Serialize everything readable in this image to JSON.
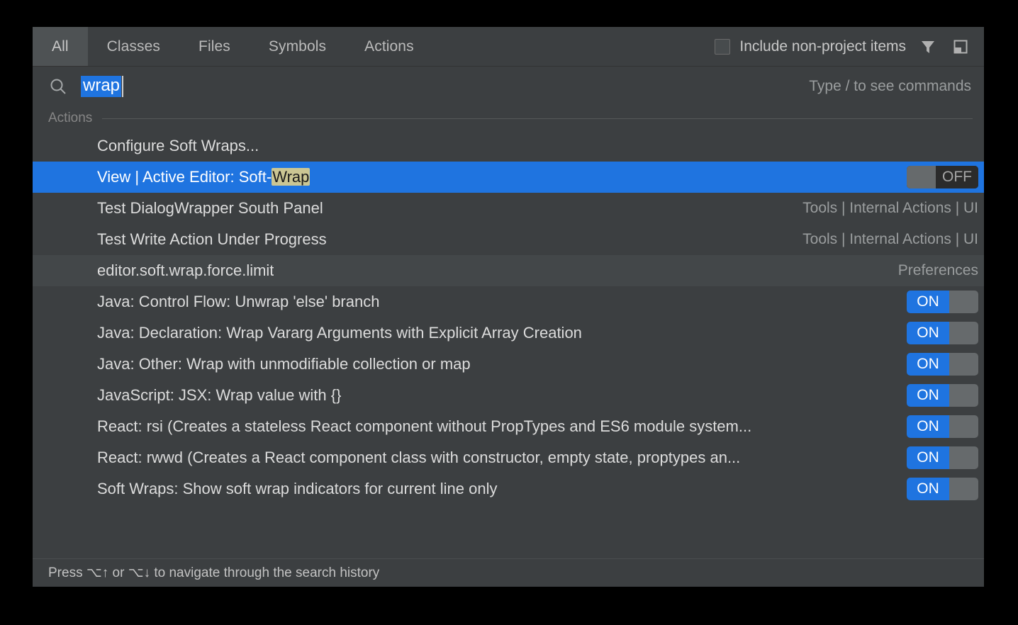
{
  "colors": {
    "dialog_bg": "#3c3f41",
    "selection_blue": "#1f74e0",
    "match_highlight": "#cbc693",
    "row_hover": "#434749",
    "tab_selected_bg": "#4e5254",
    "secondary_text": "#9a9d9e",
    "toggle_knob": "#666a6c",
    "toggle_off_bg": "#2b2b2b"
  },
  "header": {
    "tabs": [
      {
        "label": "All",
        "selected": true
      },
      {
        "label": "Classes",
        "selected": false
      },
      {
        "label": "Files",
        "selected": false
      },
      {
        "label": "Symbols",
        "selected": false
      },
      {
        "label": "Actions",
        "selected": false
      }
    ],
    "non_project": {
      "label": "Include non-project items",
      "checked": false
    },
    "icons": [
      {
        "name": "filter-icon"
      },
      {
        "name": "preview-panel-icon"
      }
    ]
  },
  "search": {
    "icon": "search-icon",
    "value": "wrap",
    "selected": true,
    "hint": "Type / to see commands"
  },
  "results": {
    "group_label": "Actions",
    "rows": [
      {
        "title": "Configure Soft Wraps...",
        "title_pre": "Configure Soft Wraps...",
        "match": "",
        "title_post": "",
        "location": "",
        "toggle": null,
        "state": "normal"
      },
      {
        "title": "View | Active Editor: Soft-Wrap",
        "title_pre": "View | Active Editor: Soft-",
        "match": "Wrap",
        "title_post": "",
        "location": "",
        "toggle": "OFF",
        "state": "selected"
      },
      {
        "title": "Test DialogWrapper South Panel",
        "title_pre": "Test DialogWrapper South Panel",
        "match": "",
        "title_post": "",
        "location": "Tools | Internal Actions | UI",
        "toggle": null,
        "state": "normal"
      },
      {
        "title": "Test Write Action Under Progress",
        "title_pre": "Test Write Action Under Progress",
        "match": "",
        "title_post": "",
        "location": "Tools | Internal Actions | UI",
        "toggle": null,
        "state": "normal"
      },
      {
        "title": "editor.soft.wrap.force.limit",
        "title_pre": "editor.soft.wrap.force.limit",
        "match": "",
        "title_post": "",
        "location": "Preferences",
        "toggle": null,
        "state": "hover"
      },
      {
        "title": "Java: Control Flow: Unwrap 'else' branch",
        "title_pre": "Java: Control Flow: Unwrap 'else' branch",
        "match": "",
        "title_post": "",
        "location": "",
        "toggle": "ON",
        "state": "normal"
      },
      {
        "title": "Java: Declaration: Wrap Vararg Arguments with Explicit Array Creation",
        "title_pre": "Java: Declaration: Wrap Vararg Arguments with Explicit Array Creation",
        "match": "",
        "title_post": "",
        "location": "",
        "toggle": "ON",
        "state": "normal"
      },
      {
        "title": "Java: Other: Wrap with unmodifiable collection or map",
        "title_pre": "Java: Other: Wrap with unmodifiable collection or map",
        "match": "",
        "title_post": "",
        "location": "",
        "toggle": "ON",
        "state": "normal"
      },
      {
        "title": "JavaScript: JSX: Wrap value with {}",
        "title_pre": "JavaScript: JSX: Wrap value with {}",
        "match": "",
        "title_post": "",
        "location": "",
        "toggle": "ON",
        "state": "normal"
      },
      {
        "title": "React: rsi (Creates a stateless React component without PropTypes and ES6 module system...",
        "title_pre": "React: rsi (Creates a stateless React component without PropTypes and ES6 module system...",
        "match": "",
        "title_post": "",
        "location": "",
        "toggle": "ON",
        "state": "normal"
      },
      {
        "title": "React: rwwd (Creates a React component class with constructor, empty state, proptypes an...",
        "title_pre": "React: rwwd (Creates a React component class with constructor, empty state, proptypes an...",
        "match": "",
        "title_post": "",
        "location": "",
        "toggle": "ON",
        "state": "normal"
      },
      {
        "title": "Soft Wraps: Show soft wrap indicators for current line only",
        "title_pre": "Soft Wraps: Show soft wrap indicators for current line only",
        "match": "",
        "title_post": "",
        "location": "",
        "toggle": "ON",
        "state": "normal"
      }
    ]
  },
  "footer": {
    "text": "Press ⌥↑ or ⌥↓ to navigate through the search history"
  }
}
